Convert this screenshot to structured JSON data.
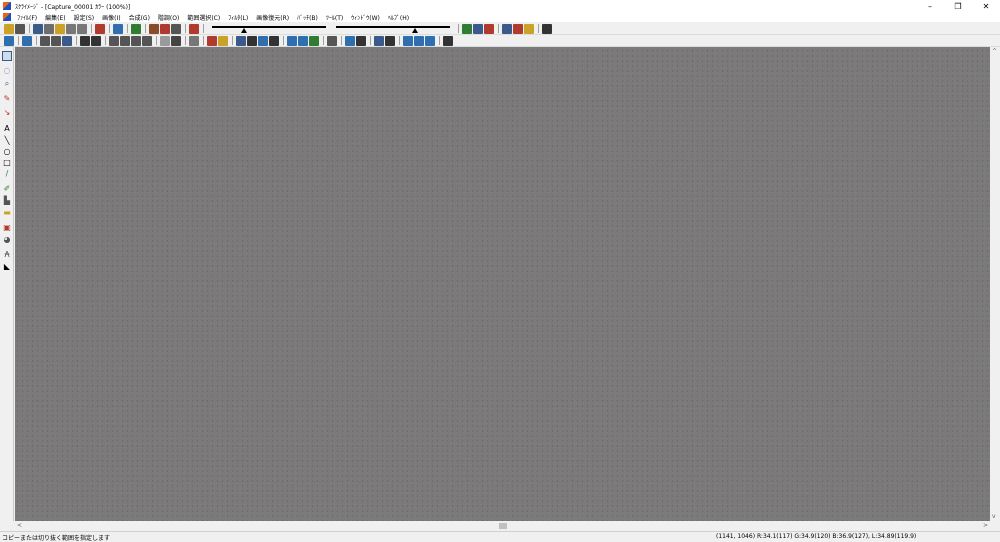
{
  "window": {
    "title": "ｽｸﾗｲﾒｰｼﾞ - [Capture_00001 ｶﾗｰ (100%)]",
    "minimize": "–",
    "maximize": "❐",
    "close": "✕"
  },
  "menu": {
    "items": [
      "ﾌｧｲﾙ(F)",
      "編集(E)",
      "設定(S)",
      "画像(I)",
      "合成(G)",
      "階調(O)",
      "範囲選択(C)",
      "ﾌｨﾙﾀ(L)",
      "画像復元(R)",
      "ﾊﾞｯﾁ(B)",
      "ﾂｰﾙ(T)",
      "ｳｨﾝﾄﾞｳ(W)",
      "ﾍﾙﾌﾟ(H)"
    ]
  },
  "toolbar1": {
    "slider1_position": 0.28,
    "slider2_position": 0.7
  },
  "status": {
    "message": "コピーまたは切り抜く範囲を指定します",
    "pixel_info": "(1141, 1046) R:34.1(117) G:34.9(120) B:36.9(127), L:34.89(119.9)"
  },
  "scroll": {
    "left_arrow": "<",
    "right_arrow": ">",
    "up_arrow": "^",
    "down_arrow": "v"
  },
  "colors": {
    "canvas_gray": "#7a7a7a",
    "chrome": "#f0f0f0"
  }
}
